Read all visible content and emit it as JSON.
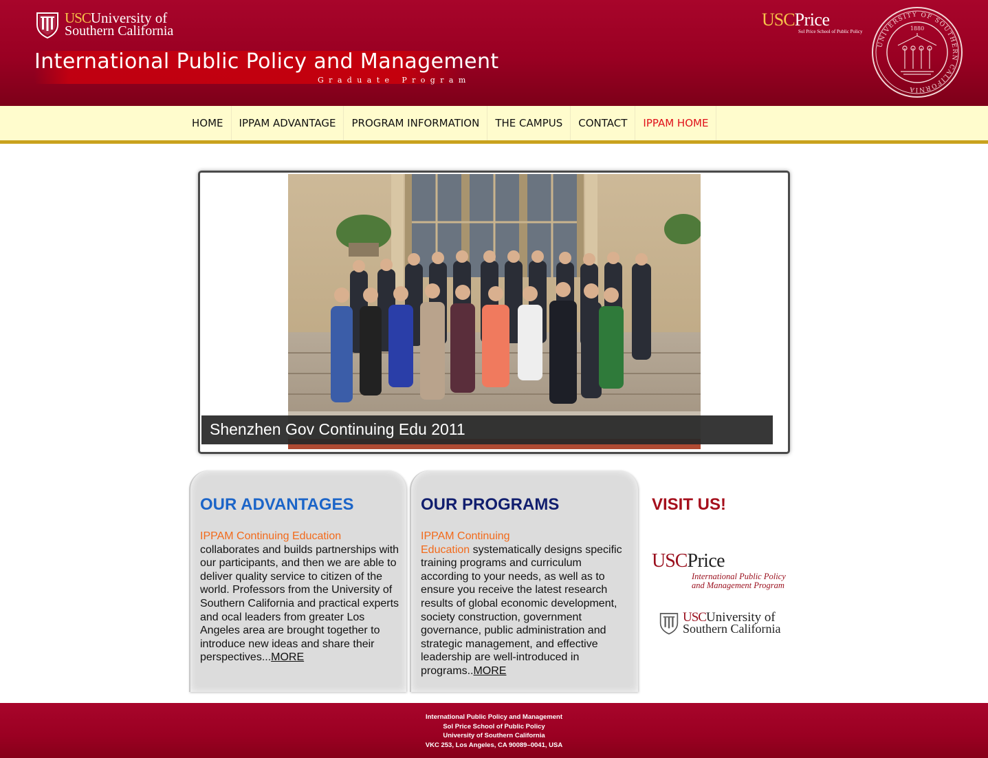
{
  "header": {
    "usc_logo": {
      "usc": "USC",
      "line1": "University of",
      "line2": "Southern California"
    },
    "banner_title": "International Public Policy and Management",
    "banner_subtitle": "Graduate Program",
    "price_logo": {
      "usc": "USC",
      "name": "Price",
      "sub": "Sol Price School of Public Policy"
    },
    "seal_text": "UNIVERSITY OF SOUTHERN CALIFORNIA",
    "seal_year": "1880"
  },
  "nav": {
    "items": [
      {
        "label": "HOME"
      },
      {
        "label": "IPPAM ADVANTAGE"
      },
      {
        "label": "PROGRAM INFORMATION"
      },
      {
        "label": "THE CAMPUS"
      },
      {
        "label": "CONTACT"
      },
      {
        "label": "IPPAM HOME",
        "active": true
      }
    ]
  },
  "slideshow": {
    "caption": "Shenzhen Gov Continuing Edu 2011"
  },
  "advantages": {
    "heading": "OUR ADVANTAGES",
    "highlight": "IPPAM Continuing Education",
    "text": "collaborates and builds partnerships with our participants, and then we are able to deliver quality service to citizen of the world. Professors from the University of Southern California and practical experts and ocal leaders from greater Los Angeles area are brought together to introduce new ideas and share their perspectives...",
    "more": "MORE"
  },
  "programs": {
    "heading": "OUR PROGRAMS",
    "highlight_line1": "IPPAM Continuing",
    "highlight_line2": "Education",
    "text": "systematically designs specific training programs and curriculum according to your needs, as well as to ensure you receive the latest research results of global economic development, society construction, government governance, public administration and strategic management, and effective leadership are well-introduced in programs..",
    "more": "MORE"
  },
  "visit": {
    "heading": "VISIT US!",
    "price_logo": {
      "usc": "USC",
      "name": "Price",
      "tag_line1": "International Public Policy",
      "tag_line2": "and Management Program"
    },
    "usc_logo": {
      "usc": "USC",
      "line1": "University of",
      "line2": "Southern California"
    }
  },
  "footer": {
    "lines": [
      "International Public Policy and Management",
      "Sol Price School of Public Policy",
      "University of Southern California",
      "VKC 253, Los Angeles, CA   90089–0041, USA"
    ]
  },
  "colors": {
    "cardinal": "#990022",
    "gold": "#f7c34a",
    "nav_bg": "#fffccd",
    "nav_border": "#c9a21e",
    "advantages_heading": "#1c65c8",
    "programs_heading": "#111e6e",
    "highlight": "#f26a1b",
    "visit_heading": "#a50f1c"
  }
}
